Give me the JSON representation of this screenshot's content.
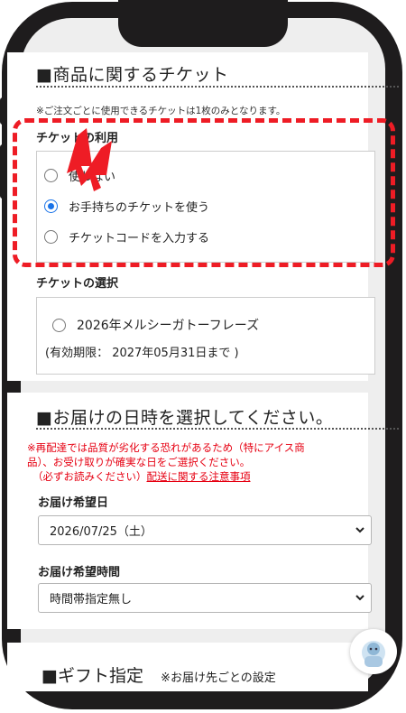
{
  "ticket_section": {
    "title": "■商品に関するチケット",
    "note": "※ご注文ごとに使用できるチケットは1枚のみとなります。",
    "usage_label": "チケットの利用",
    "options": [
      {
        "label": "使わない",
        "checked": false
      },
      {
        "label": "お手持ちのチケットを使う",
        "checked": true
      },
      {
        "label": "チケットコードを入力する",
        "checked": false
      }
    ],
    "selection_label": "チケットの選択",
    "ticket_name": "2026年メルシーガトーフレーズ",
    "ticket_expiry": "(有効期限： 2027年05月31日まで )"
  },
  "delivery_section": {
    "title": "■お届けの日時を選択してください。",
    "warning_line1": "※再配達では品質が劣化する恐れがあるため（特にアイス商",
    "warning_line2": "品）、お受け取りが確実な日をご選択ください。",
    "warning_line3_prefix": "（必ずお読みください）",
    "warning_link": "配送に関する注意事項",
    "date_label": "お届け希望日",
    "date_value": "2026/07/25（土）",
    "time_label": "お届け希望時間",
    "time_value": "時間帯指定無し"
  },
  "gift_section": {
    "title": "■ギフト指定",
    "note": "※お届け先ごとの設定"
  },
  "colors": {
    "accent_red": "#e60012",
    "radio_blue": "#1a73e8",
    "frame": "#1e1c1d"
  },
  "icons": [
    "chevron-down-icon",
    "arrow-pointer-icon",
    "chat-assistant-icon"
  ]
}
